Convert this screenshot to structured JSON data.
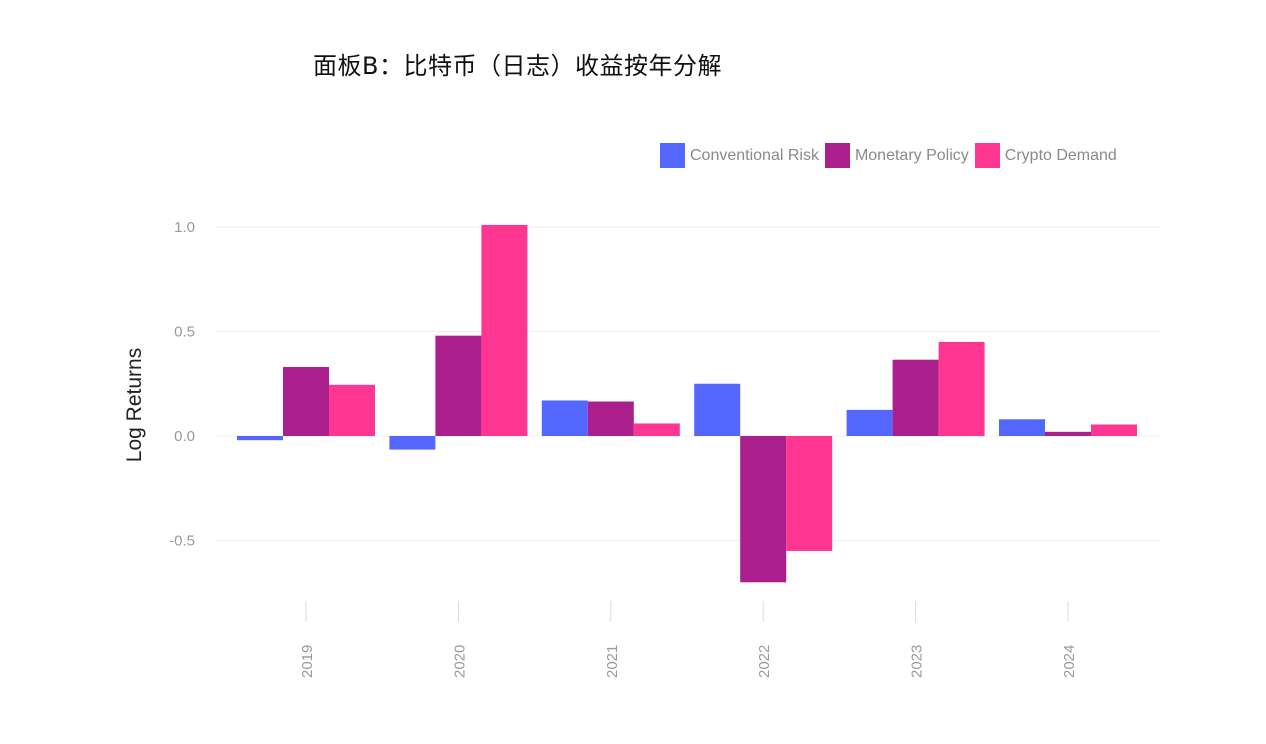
{
  "title": "面板B：比特币（日志）收益按年分解",
  "chart_data": {
    "type": "bar",
    "title": "面板B：比特币（日志）收益按年分解",
    "xlabel": "",
    "ylabel": "Log Returns",
    "categories": [
      "2019",
      "2020",
      "2021",
      "2022",
      "2023",
      "2024"
    ],
    "series": [
      {
        "name": "Conventional Risk",
        "color": "#5468FF",
        "values": [
          -0.02,
          -0.065,
          0.17,
          0.25,
          0.125,
          0.08
        ]
      },
      {
        "name": "Monetary Policy",
        "color": "#AA1F8C",
        "values": [
          0.33,
          0.48,
          0.165,
          -0.7,
          0.365,
          0.02
        ]
      },
      {
        "name": "Crypto Demand",
        "color": "#FF3592",
        "values": [
          0.245,
          1.01,
          0.06,
          -0.55,
          0.45,
          0.055
        ]
      }
    ],
    "ylim": [
      -0.8,
      1.0
    ],
    "yticks": [
      -0.5,
      0.0,
      0.5,
      1.0
    ],
    "ytick_labels": [
      "-0.5",
      "0.0",
      "0.5",
      "1.0"
    ],
    "grid": true,
    "legend_position": "top-right",
    "xtick_rotation": "vertical"
  }
}
